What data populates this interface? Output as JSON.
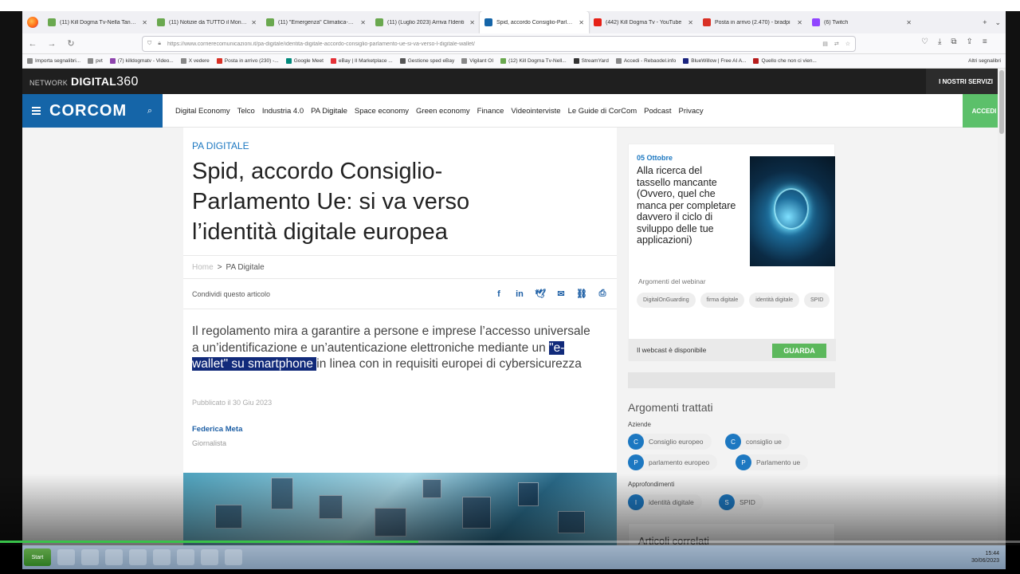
{
  "browser": {
    "tabs": [
      {
        "title": "(11) Kill Dogma Tv-Nella Tana de",
        "color": "#6aa84f",
        "active": false
      },
      {
        "title": "(11) Notizie da TUTTO il Mondo |",
        "color": "#6aa84f",
        "active": false
      },
      {
        "title": "(11) \"Emergenza\" Climatica-Cre",
        "color": "#6aa84f",
        "active": false
      },
      {
        "title": "(11) (Luglio 2023) Arriva l'Identi",
        "color": "#6aa84f",
        "active": false
      },
      {
        "title": "Spid, accordo Consiglio-Parlame",
        "color": "#1565a8",
        "active": true
      },
      {
        "title": "(442) Kill Dogma Tv - YouTube",
        "color": "#e62117",
        "active": false
      },
      {
        "title": "Posta in arrivo (2.470) - bradpi",
        "color": "#d93025",
        "active": false
      },
      {
        "title": "(6) Twitch",
        "color": "#9146ff",
        "active": false
      }
    ],
    "url": "https://www.corrierecomunicazioni.it/pa-digitale/identita-digitale-accordo-consiglio-parlamento-ue-si-va-verso-l-digitale-wallet/",
    "bookmarks": [
      {
        "label": "Importa segnalibri...",
        "color": "#888"
      },
      {
        "label": "pvt",
        "color": "#888"
      },
      {
        "label": "(7) killdogmatv - Video...",
        "color": "#8e44ad"
      },
      {
        "label": "X vedere",
        "color": "#888"
      },
      {
        "label": "Posta in arrivo (230) -...",
        "color": "#d93025"
      },
      {
        "label": "Google Meet",
        "color": "#00897b"
      },
      {
        "label": "eBay | Il Marketplace ...",
        "color": "#e53238"
      },
      {
        "label": "Gestione sped eBay",
        "color": "#555"
      },
      {
        "label": "Vigilant OI",
        "color": "#888"
      },
      {
        "label": "(12) Kill Dogma Tv-Nell...",
        "color": "#6aa84f"
      },
      {
        "label": "StreamYard",
        "color": "#333"
      },
      {
        "label": "Accedi - Rebaodel.info",
        "color": "#888"
      },
      {
        "label": "BlueWillow | Free AI A...",
        "color": "#1a237e"
      },
      {
        "label": "Quello che non ci vien...",
        "color": "#b71c1c"
      }
    ],
    "other_bookmarks": "Altri segnalibri"
  },
  "site": {
    "network_prefix": "NETWORK",
    "network_name": "DIGITAL",
    "network_num": "360",
    "services": "I NOSTRI SERVIZI",
    "brand": "CORCOM",
    "menu": [
      "Digital Economy",
      "Telco",
      "Industria 4.0",
      "PA Digitale",
      "Space economy",
      "Green economy",
      "Finance",
      "Videointerviste",
      "Le Guide di CorCom",
      "Podcast",
      "Privacy"
    ],
    "login": "ACCEDI",
    "accent": "#1565a8"
  },
  "article": {
    "category": "PA DIGITALE",
    "title": "Spid, accordo Consiglio-Parlamento Ue: si va verso l’identità digitale europea",
    "breadcrumb_home": "Home",
    "breadcrumb_sep": ">",
    "breadcrumb_section": "PA Digitale",
    "share_label": "Condividi questo articolo",
    "lead_before": "Il regolamento mira a garantire a persone e imprese l’accesso universale a un’identificazione e un’autenticazione elettroniche mediante un ",
    "lead_highlight": "\"e-wallet\" su smartphone ",
    "lead_after": "in linea con in requisiti europei di cybersicurezza",
    "published": "Pubblicato il 30 Giu 2023",
    "author": "Federica Meta",
    "role": "Giornalista"
  },
  "sidebar": {
    "webinar_date": "05 Ottobre",
    "webinar_title": "Alla ricerca del tassello mancante (Ovvero, quel che manca per completare davvero il ciclo di sviluppo delle tue applicazioni)",
    "topics_label": "Argomenti del webinar",
    "topics": [
      "DigitalOnGuarding",
      "firma digitale",
      "identità digitale",
      "SPID"
    ],
    "webcast": "Il webcast è disponibile",
    "watch": "GUARDA",
    "argomenti": "Argomenti trattati",
    "aziende_label": "Aziende",
    "aziende": [
      {
        "letter": "C",
        "name": "Consiglio europeo"
      },
      {
        "letter": "C",
        "name": "consiglio ue"
      },
      {
        "letter": "P",
        "name": "parlamento europeo"
      },
      {
        "letter": "P",
        "name": "Parlamento ue"
      }
    ],
    "approf_label": "Approfondimenti",
    "approf": [
      {
        "letter": "I",
        "name": "identità digitale"
      },
      {
        "letter": "S",
        "name": "SPID"
      }
    ],
    "correlati": "Articoli correlati"
  },
  "video": {
    "progress": 0.41
  },
  "taskbar": {
    "start": "Start",
    "clock_time": "15:44",
    "clock_date": "30/06/2023"
  }
}
